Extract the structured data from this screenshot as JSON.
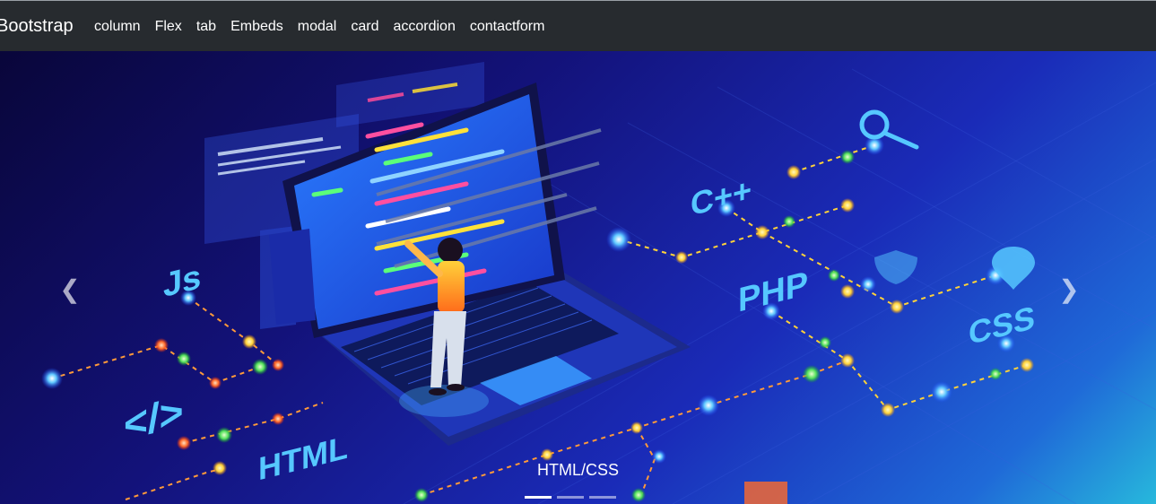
{
  "navbar": {
    "brand": "Bootstrap",
    "links": [
      "column",
      "Flex",
      "tab",
      "Embeds",
      "modal",
      "card",
      "accordion",
      "contactform"
    ]
  },
  "carousel": {
    "caption": "HTML/CSS",
    "controls": {
      "prev_icon": "chevron-left-icon",
      "next_icon": "chevron-right-icon"
    },
    "slide_count": 3,
    "active_index": 0,
    "tech_labels": [
      "C++",
      "Js",
      "PHP",
      "CSS",
      "</>",
      "HTML"
    ]
  },
  "colors": {
    "navbar_bg": "#272b2f",
    "bg_dark": "#09063a",
    "bg_light": "#27b8dc"
  }
}
